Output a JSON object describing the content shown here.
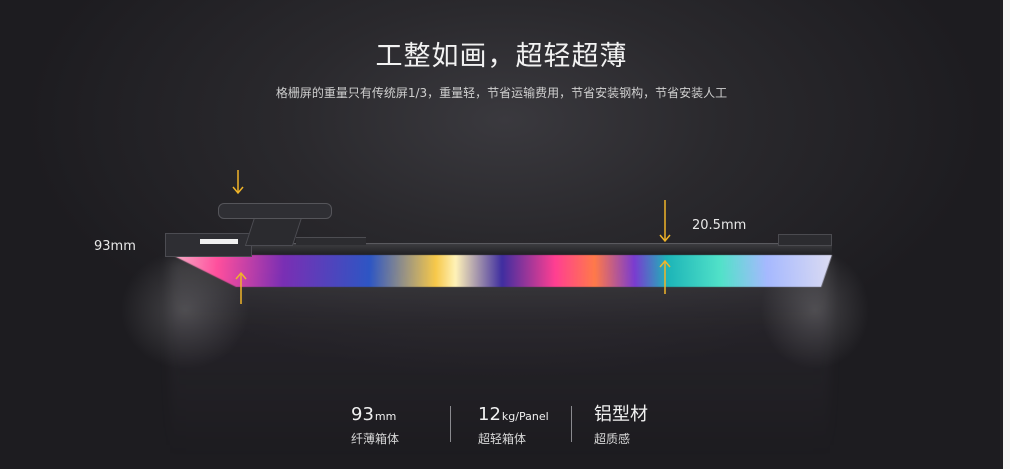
{
  "hero": {
    "title": "工整如画，超轻超薄",
    "subtitle": "格栅屏的重量只有传统屏1/3，重量轻，节省运输费用，节省安装钢构，节省安装人工"
  },
  "dimensions": {
    "height_label": "93mm",
    "thickness_label": "20.5mm"
  },
  "specs": [
    {
      "value": "93",
      "unit": "mm",
      "caption": "纤薄箱体"
    },
    {
      "value": "12",
      "unit": "kg/Panel",
      "caption": "超轻箱体"
    },
    {
      "value": "铝型材",
      "unit": "",
      "caption": "超质感"
    }
  ],
  "colors": {
    "background": "#2a292d",
    "accent_arrow": "#f0b429",
    "text": "#f2f2f2"
  }
}
